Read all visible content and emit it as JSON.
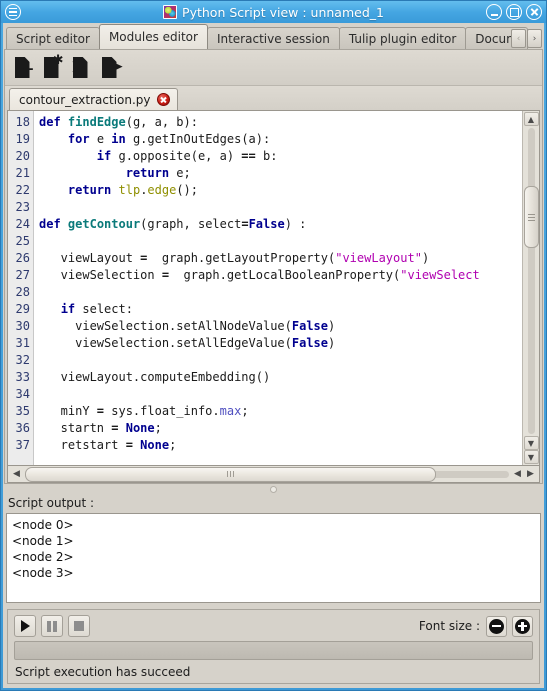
{
  "window": {
    "title": "Python Script view : unnamed_1",
    "menu_icon": "hamburger-icon",
    "app_icon": "tulip-app-icon",
    "minimize_label": "",
    "maximize_label": "",
    "close_label": ""
  },
  "tabs": [
    {
      "label": "Script editor",
      "active": false
    },
    {
      "label": "Modules editor",
      "active": true
    },
    {
      "label": "Interactive session",
      "active": false
    },
    {
      "label": "Tulip plugin editor",
      "active": false
    },
    {
      "label": "Docum",
      "active": false
    }
  ],
  "tab_scrollers": {
    "prev": "‹",
    "next": "›"
  },
  "toolbar": [
    {
      "name": "new-module-button",
      "icon": "document-plus-icon",
      "badge": "+"
    },
    {
      "name": "new-from-template-button",
      "icon": "document-star-icon",
      "badge": "✱"
    },
    {
      "name": "import-module-button",
      "icon": "document-arrow-in-icon",
      "badge": "➜"
    },
    {
      "name": "export-module-button",
      "icon": "document-arrow-out-icon",
      "badge": "➜"
    }
  ],
  "file_tabs": [
    {
      "label": "contour_extraction.py",
      "closable": true
    }
  ],
  "editor": {
    "first_line": 18,
    "lines": [
      {
        "n": 18,
        "html": "<span class=\"kw\">def</span> <span class=\"fn\">findEdge</span>(g, a, b):"
      },
      {
        "n": 19,
        "html": "    <span class=\"kw\">for</span> e <span class=\"kw\">in</span> g.getInOutEdges(a):"
      },
      {
        "n": 20,
        "html": "        <span class=\"kw\">if</span> g.opposite(e, a) <span class=\"op\">==</span> b:"
      },
      {
        "n": 21,
        "html": "            <span class=\"kw\">return</span> e;"
      },
      {
        "n": 22,
        "html": "    <span class=\"kw\">return</span> <span class=\"mem\">tlp</span>.<span class=\"mem\">edge</span>();"
      },
      {
        "n": 23,
        "html": ""
      },
      {
        "n": 24,
        "html": "<span class=\"kw\">def</span> <span class=\"fn\">getContour</span>(graph, select<span class=\"op\">=</span><span class=\"kw\">False</span>) :"
      },
      {
        "n": 25,
        "html": ""
      },
      {
        "n": 26,
        "html": "   viewLayout <span class=\"op\">=</span>  graph.getLayoutProperty(<span class=\"str\">\"viewLayout\"</span>)"
      },
      {
        "n": 27,
        "html": "   viewSelection <span class=\"op\">=</span>  graph.getLocalBooleanProperty(<span class=\"str\">\"viewSelect</span>"
      },
      {
        "n": 28,
        "html": ""
      },
      {
        "n": 29,
        "html": "   <span class=\"kw\">if</span> select:"
      },
      {
        "n": 30,
        "html": "     viewSelection.setAllNodeValue(<span class=\"kw\">False</span>)"
      },
      {
        "n": 31,
        "html": "     viewSelection.setAllEdgeValue(<span class=\"kw\">False</span>)"
      },
      {
        "n": 32,
        "html": ""
      },
      {
        "n": 33,
        "html": "   viewLayout.computeEmbedding()"
      },
      {
        "n": 34,
        "html": ""
      },
      {
        "n": 35,
        "html": "   minY <span class=\"op\">=</span> sys.float_info.<span class=\"attr\">max</span>;"
      },
      {
        "n": 36,
        "html": "   startn <span class=\"op\">=</span> <span class=\"kw\">None</span>;"
      },
      {
        "n": 37,
        "html": "   retstart <span class=\"op\">=</span> <span class=\"kw\">None</span>;"
      }
    ],
    "plain_lines": [
      "def findEdge(g, a, b):",
      "    for e in g.getInOutEdges(a):",
      "        if g.opposite(e, a) == b:",
      "            return e;",
      "    return tlp.edge();",
      "",
      "def getContour(graph, select=False) :",
      "",
      "   viewLayout =  graph.getLayoutProperty(\"viewLayout\")",
      "   viewSelection =  graph.getLocalBooleanProperty(\"viewSelect",
      "",
      "   if select:",
      "     viewSelection.setAllNodeValue(False)",
      "     viewSelection.setAllEdgeValue(False)",
      "",
      "   viewLayout.computeEmbedding()",
      "",
      "   minY = sys.float_info.max;",
      "   startn = None;",
      "   retstart = None;"
    ]
  },
  "output": {
    "label": "Script output :",
    "lines": [
      "<node 0>",
      "<node 1>",
      "<node 2>",
      "<node 3>"
    ]
  },
  "controls": {
    "play": "run-script",
    "pause": "pause-script",
    "stop": "stop-script",
    "font_size_label": "Font size :",
    "decrease": "−",
    "increase": "+"
  },
  "status": {
    "message": "Script execution has succeed"
  },
  "colors": {
    "titlebar": "#45a6e2",
    "panel": "#d6d2ca",
    "keyword": "#00008f",
    "function": "#0a7a7a",
    "string": "#b000b0",
    "member": "#8f8f00",
    "gutter_text": "#2e3a6e"
  }
}
